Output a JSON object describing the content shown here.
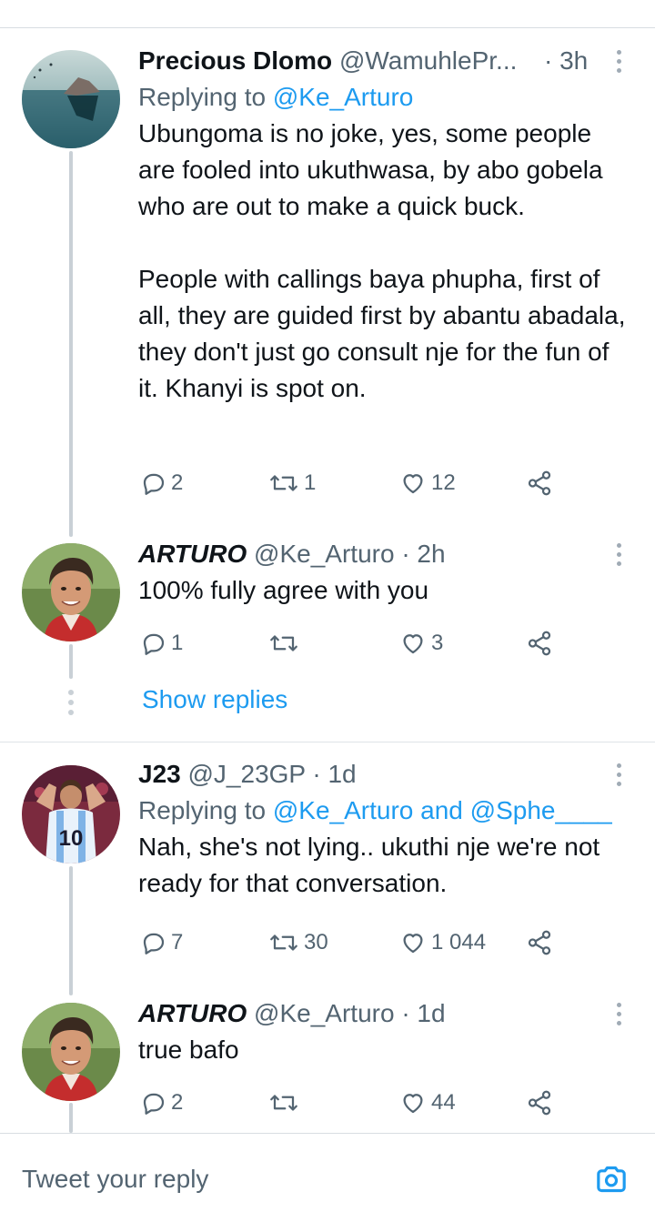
{
  "tweets": [
    {
      "name": "Precious Dlomo",
      "handle": "@WamuhlePr...",
      "time": "· 3h",
      "replying_prefix": "Replying to ",
      "replying_to": "@Ke_Arturo",
      "paragraphs": [
        "Ubungoma is no joke, yes, some people are fooled into ukuthwasa, by abo gobela who are out to make a quick buck.",
        "People with callings baya phupha, first of all, they are guided first by abantu abadala, they don't just go consult nje for the fun of it. Khanyi is spot on."
      ],
      "replies": "2",
      "retweets": "1",
      "likes": "12"
    },
    {
      "name": "ARTURO",
      "handle": "@Ke_Arturo",
      "time": "· 2h",
      "text": "100% fully agree with you",
      "replies": "1",
      "retweets": "",
      "likes": "3"
    },
    {
      "name": "J23",
      "handle": "@J_23GP",
      "time": "· 1d",
      "replying_prefix": "Replying to ",
      "replying_to": "@Ke_Arturo and @Sphe____",
      "text": "Nah, she's not lying.. ukuthi nje we're not ready for that conversation.",
      "replies": "7",
      "retweets": "30",
      "likes": "1 044"
    },
    {
      "name": "ARTURO",
      "handle": "@Ke_Arturo",
      "time": "· 1d",
      "text": "true bafo",
      "replies": "2",
      "retweets": "",
      "likes": "44"
    }
  ],
  "show_replies_label": "Show replies",
  "reply_placeholder": "Tweet your reply",
  "icons": {
    "reply": "reply-icon",
    "retweet": "retweet-icon",
    "like": "heart-icon",
    "share": "share-icon",
    "more": "more-icon",
    "camera": "camera-icon"
  },
  "colors": {
    "link": "#1d9bf0",
    "secondary_text": "#536471",
    "primary_text": "#0f1419"
  }
}
